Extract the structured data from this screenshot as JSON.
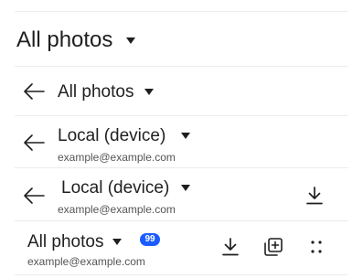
{
  "header": {
    "title": "All photos"
  },
  "variant_a": {
    "title": "All photos"
  },
  "variant_b": {
    "title": "Local (device)",
    "subtitle": "example@example.com"
  },
  "variant_c": {
    "title": "Local (device)",
    "subtitle": "example@example.com"
  },
  "variant_d": {
    "title": "All photos",
    "subtitle": "example@example.com",
    "badge": "99"
  },
  "colors": {
    "badge": "#1a5cff",
    "text": "#1f1f1f",
    "subtext": "#555555",
    "divider": "#ececec"
  },
  "icons": [
    "back-arrow-icon",
    "caret-down-icon",
    "download-icon",
    "add-to-album-icon",
    "more-options-icon"
  ]
}
